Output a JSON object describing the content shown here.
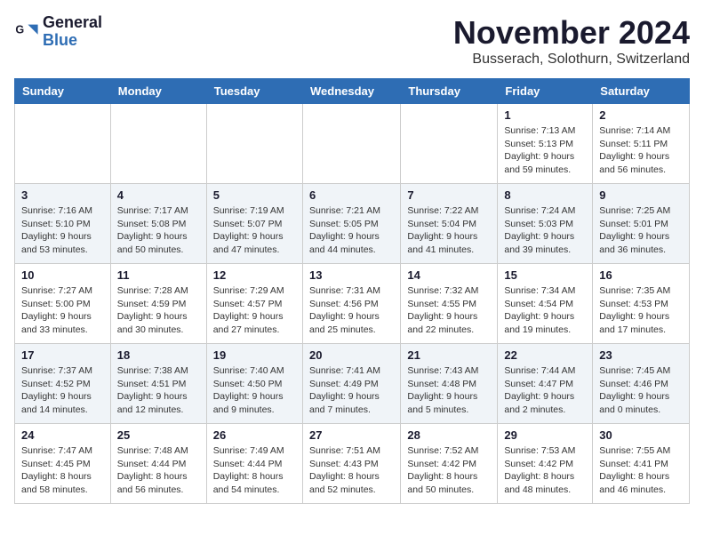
{
  "header": {
    "logo_line1": "General",
    "logo_line2": "Blue",
    "month_title": "November 2024",
    "location": "Busserach, Solothurn, Switzerland"
  },
  "weekdays": [
    "Sunday",
    "Monday",
    "Tuesday",
    "Wednesday",
    "Thursday",
    "Friday",
    "Saturday"
  ],
  "weeks": [
    [
      {
        "day": "",
        "info": ""
      },
      {
        "day": "",
        "info": ""
      },
      {
        "day": "",
        "info": ""
      },
      {
        "day": "",
        "info": ""
      },
      {
        "day": "",
        "info": ""
      },
      {
        "day": "1",
        "info": "Sunrise: 7:13 AM\nSunset: 5:13 PM\nDaylight: 9 hours\nand 59 minutes."
      },
      {
        "day": "2",
        "info": "Sunrise: 7:14 AM\nSunset: 5:11 PM\nDaylight: 9 hours\nand 56 minutes."
      }
    ],
    [
      {
        "day": "3",
        "info": "Sunrise: 7:16 AM\nSunset: 5:10 PM\nDaylight: 9 hours\nand 53 minutes."
      },
      {
        "day": "4",
        "info": "Sunrise: 7:17 AM\nSunset: 5:08 PM\nDaylight: 9 hours\nand 50 minutes."
      },
      {
        "day": "5",
        "info": "Sunrise: 7:19 AM\nSunset: 5:07 PM\nDaylight: 9 hours\nand 47 minutes."
      },
      {
        "day": "6",
        "info": "Sunrise: 7:21 AM\nSunset: 5:05 PM\nDaylight: 9 hours\nand 44 minutes."
      },
      {
        "day": "7",
        "info": "Sunrise: 7:22 AM\nSunset: 5:04 PM\nDaylight: 9 hours\nand 41 minutes."
      },
      {
        "day": "8",
        "info": "Sunrise: 7:24 AM\nSunset: 5:03 PM\nDaylight: 9 hours\nand 39 minutes."
      },
      {
        "day": "9",
        "info": "Sunrise: 7:25 AM\nSunset: 5:01 PM\nDaylight: 9 hours\nand 36 minutes."
      }
    ],
    [
      {
        "day": "10",
        "info": "Sunrise: 7:27 AM\nSunset: 5:00 PM\nDaylight: 9 hours\nand 33 minutes."
      },
      {
        "day": "11",
        "info": "Sunrise: 7:28 AM\nSunset: 4:59 PM\nDaylight: 9 hours\nand 30 minutes."
      },
      {
        "day": "12",
        "info": "Sunrise: 7:29 AM\nSunset: 4:57 PM\nDaylight: 9 hours\nand 27 minutes."
      },
      {
        "day": "13",
        "info": "Sunrise: 7:31 AM\nSunset: 4:56 PM\nDaylight: 9 hours\nand 25 minutes."
      },
      {
        "day": "14",
        "info": "Sunrise: 7:32 AM\nSunset: 4:55 PM\nDaylight: 9 hours\nand 22 minutes."
      },
      {
        "day": "15",
        "info": "Sunrise: 7:34 AM\nSunset: 4:54 PM\nDaylight: 9 hours\nand 19 minutes."
      },
      {
        "day": "16",
        "info": "Sunrise: 7:35 AM\nSunset: 4:53 PM\nDaylight: 9 hours\nand 17 minutes."
      }
    ],
    [
      {
        "day": "17",
        "info": "Sunrise: 7:37 AM\nSunset: 4:52 PM\nDaylight: 9 hours\nand 14 minutes."
      },
      {
        "day": "18",
        "info": "Sunrise: 7:38 AM\nSunset: 4:51 PM\nDaylight: 9 hours\nand 12 minutes."
      },
      {
        "day": "19",
        "info": "Sunrise: 7:40 AM\nSunset: 4:50 PM\nDaylight: 9 hours\nand 9 minutes."
      },
      {
        "day": "20",
        "info": "Sunrise: 7:41 AM\nSunset: 4:49 PM\nDaylight: 9 hours\nand 7 minutes."
      },
      {
        "day": "21",
        "info": "Sunrise: 7:43 AM\nSunset: 4:48 PM\nDaylight: 9 hours\nand 5 minutes."
      },
      {
        "day": "22",
        "info": "Sunrise: 7:44 AM\nSunset: 4:47 PM\nDaylight: 9 hours\nand 2 minutes."
      },
      {
        "day": "23",
        "info": "Sunrise: 7:45 AM\nSunset: 4:46 PM\nDaylight: 9 hours\nand 0 minutes."
      }
    ],
    [
      {
        "day": "24",
        "info": "Sunrise: 7:47 AM\nSunset: 4:45 PM\nDaylight: 8 hours\nand 58 minutes."
      },
      {
        "day": "25",
        "info": "Sunrise: 7:48 AM\nSunset: 4:44 PM\nDaylight: 8 hours\nand 56 minutes."
      },
      {
        "day": "26",
        "info": "Sunrise: 7:49 AM\nSunset: 4:44 PM\nDaylight: 8 hours\nand 54 minutes."
      },
      {
        "day": "27",
        "info": "Sunrise: 7:51 AM\nSunset: 4:43 PM\nDaylight: 8 hours\nand 52 minutes."
      },
      {
        "day": "28",
        "info": "Sunrise: 7:52 AM\nSunset: 4:42 PM\nDaylight: 8 hours\nand 50 minutes."
      },
      {
        "day": "29",
        "info": "Sunrise: 7:53 AM\nSunset: 4:42 PM\nDaylight: 8 hours\nand 48 minutes."
      },
      {
        "day": "30",
        "info": "Sunrise: 7:55 AM\nSunset: 4:41 PM\nDaylight: 8 hours\nand 46 minutes."
      }
    ]
  ],
  "colors": {
    "header_bg": "#2e6db4",
    "header_text": "#ffffff",
    "title_text": "#1a1a2e",
    "logo_blue": "#2e6db4"
  }
}
